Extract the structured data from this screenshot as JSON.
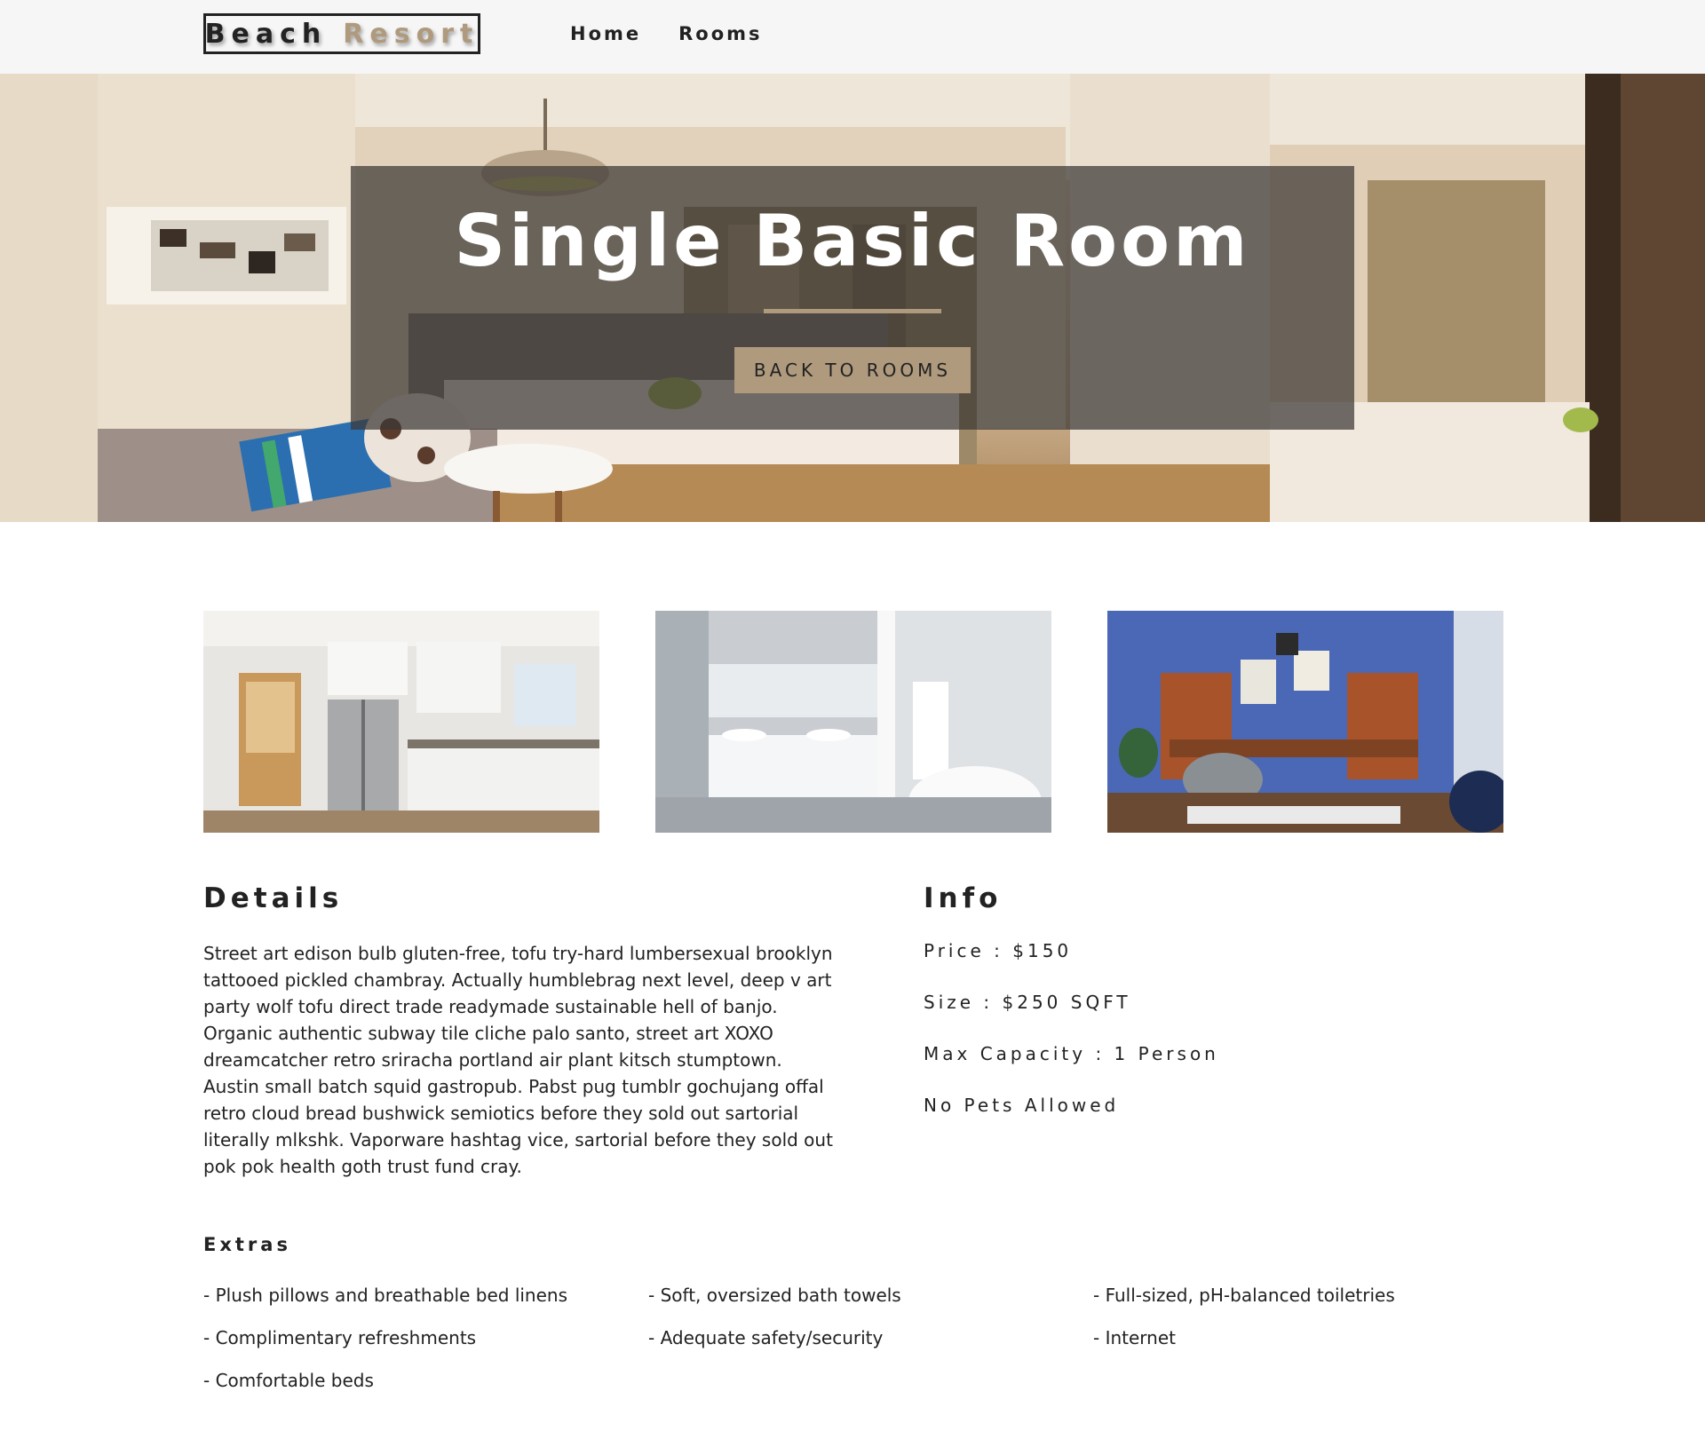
{
  "navbar": {
    "logo_word1": "Beach",
    "logo_word2": "Resort",
    "links": [
      "Home",
      "Rooms"
    ]
  },
  "hero": {
    "title": "Single Basic Room",
    "button_label": "BACK TO ROOMS"
  },
  "colors": {
    "accent": "#af9a7d",
    "navbar_bg": "#f6f6f6",
    "text": "#222222",
    "banner_overlay": "rgba(60,55,52,0.72)"
  },
  "gallery": [
    {
      "name": "kitchen-photo"
    },
    {
      "name": "bathroom-photo"
    },
    {
      "name": "living-room-photo"
    }
  ],
  "details": {
    "title": "Details",
    "text": "Street art edison bulb gluten-free, tofu try-hard lumbersexual brooklyn tattooed pickled chambray. Actually humblebrag next level, deep v art party wolf tofu direct trade readymade sustainable hell of banjo. Organic authentic subway tile cliche palo santo, street art XOXO dreamcatcher retro sriracha portland air plant kitsch stumptown. Austin small batch squid gastropub. Pabst pug tumblr gochujang offal retro cloud bread bushwick semiotics before they sold out sartorial literally mlkshk. Vaporware hashtag vice, sartorial before they sold out pok pok health goth trust fund cray."
  },
  "info": {
    "title": "Info",
    "items": [
      "Price : $150",
      "Size : $250 SQFT",
      "Max Capacity : 1 Person",
      "No Pets Allowed"
    ]
  },
  "extras": {
    "title": "Extras",
    "items": [
      "- Plush pillows and breathable bed linens",
      "- Soft, oversized bath towels",
      "- Full-sized, pH-balanced toiletries",
      "- Complimentary refreshments",
      "- Adequate safety/security",
      "- Internet",
      "- Comfortable beds"
    ]
  }
}
